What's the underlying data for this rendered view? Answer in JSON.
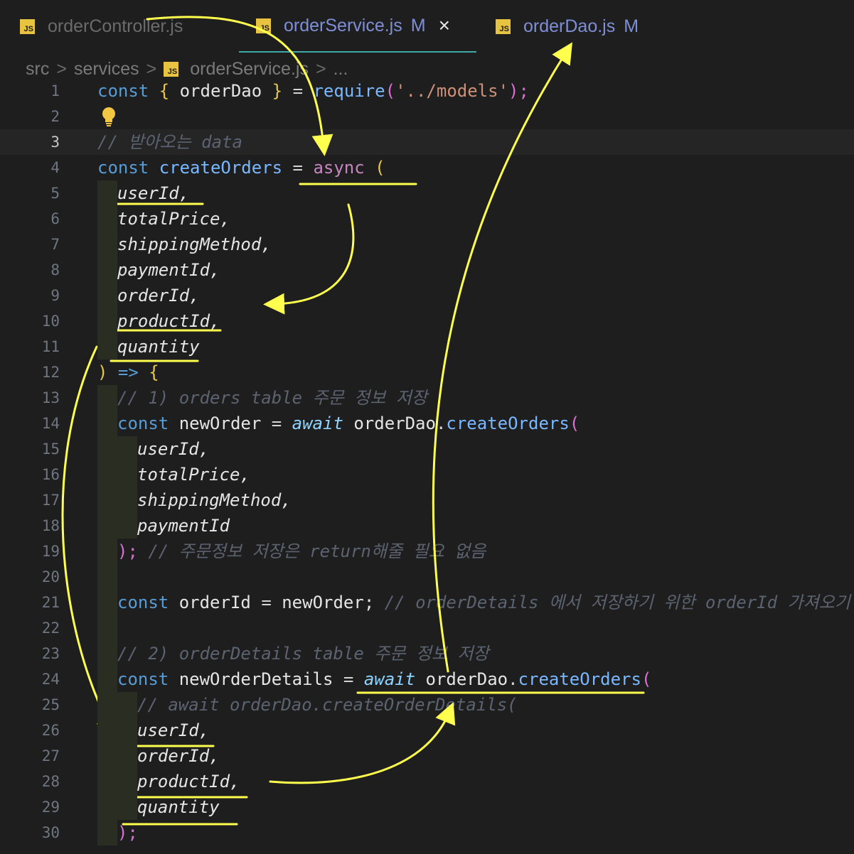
{
  "tabs": [
    {
      "label": "orderController.js",
      "icon": "js-file-icon",
      "modified": "",
      "active": false
    },
    {
      "label": "orderService.js",
      "icon": "js-file-icon",
      "modified": "M",
      "active": true,
      "close": "×"
    },
    {
      "label": "orderDao.js",
      "icon": "js-file-icon",
      "modified": "M",
      "active": false
    }
  ],
  "breadcrumb": {
    "parts": [
      "src",
      "services",
      "orderService.js",
      "..."
    ],
    "separator": ">"
  },
  "file_icon_text": "JS",
  "current_line": 3,
  "code": {
    "line1": {
      "kw": "const",
      "open": "{",
      "name": "orderDao",
      "close": "}",
      "eq": "=",
      "fn": "require",
      "lp": "(",
      "str": "'../models'",
      "rp": ");"
    },
    "line3": "// 받아오는 data",
    "line4": {
      "kw": "const",
      "name": "createOrders",
      "eq": "=",
      "async": "async",
      "paren": "("
    },
    "params": [
      "userId,",
      "totalPrice,",
      "shippingMethod,",
      "paymentId,",
      "orderId,",
      "productId,",
      "quantity"
    ],
    "line12": {
      "rp": ")",
      "arrow": "=>",
      "brace": "{"
    },
    "line13": "// 1) orders table 주문 정보 저장",
    "line14": {
      "kw": "const",
      "name": "newOrder",
      "eq": "=",
      "await": "await",
      "obj": "orderDao",
      "dot": ".",
      "fn": "createOrders",
      "paren": "("
    },
    "args1": [
      "userId,",
      "totalPrice,",
      "shippingMethod,",
      "paymentId"
    ],
    "line19": {
      "rp": ");",
      "cm": "// 주문정보 저장은 return해줄 필요 없음"
    },
    "line21": {
      "kw": "const",
      "name": "orderId",
      "eq": "=",
      "val": "newOrder;",
      "cm": "// orderDetails 에서 저장하기 위한 orderId 가져오기"
    },
    "line23": "// 2) orderDetails table 주문 정보 저장",
    "line24": {
      "kw": "const",
      "name": "newOrderDetails",
      "eq": "=",
      "await": "await",
      "obj": "orderDao",
      "dot": ".",
      "fn": "createOrders",
      "paren": "("
    },
    "line25": "// await orderDao.createOrderDetails(",
    "args2": [
      "userId,",
      "orderId,",
      "productId,",
      "quantity"
    ],
    "line30": ");"
  },
  "line_numbers": [
    "1",
    "2",
    "3",
    "4",
    "5",
    "6",
    "7",
    "8",
    "9",
    "10",
    "11",
    "12",
    "13",
    "14",
    "15",
    "16",
    "17",
    "18",
    "19",
    "20",
    "21",
    "22",
    "23",
    "24",
    "25",
    "26",
    "27",
    "28",
    "29",
    "30"
  ],
  "colors": {
    "annotation": "#ffff4d",
    "accent": "#3fa7a7"
  }
}
